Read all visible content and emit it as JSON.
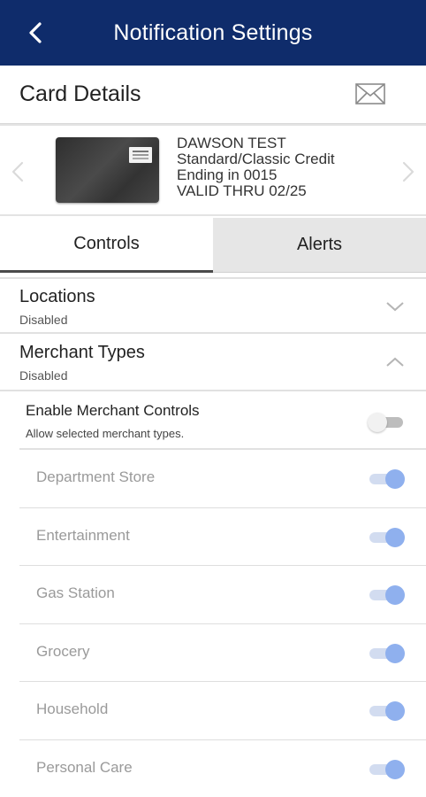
{
  "header": {
    "title": "Notification Settings"
  },
  "card_details": {
    "title": "Card Details"
  },
  "card": {
    "name": "DAWSON TEST",
    "type": "Standard/Classic Credit",
    "ending": "Ending in 0015",
    "valid": "VALID THRU 02/25"
  },
  "tabs": [
    {
      "label": "Controls",
      "active": true
    },
    {
      "label": "Alerts",
      "active": false
    }
  ],
  "sections": {
    "locations": {
      "title": "Locations",
      "status": "Disabled",
      "expanded": false
    },
    "merchant_types": {
      "title": "Merchant Types",
      "status": "Disabled",
      "expanded": true
    }
  },
  "enable_merchant": {
    "title": "Enable Merchant Controls",
    "subtitle": "Allow selected merchant types.",
    "enabled": false
  },
  "merchants": [
    {
      "label": "Department Store",
      "on": true
    },
    {
      "label": "Entertainment",
      "on": true
    },
    {
      "label": "Gas Station",
      "on": true
    },
    {
      "label": "Grocery",
      "on": true
    },
    {
      "label": "Household",
      "on": true
    },
    {
      "label": "Personal Care",
      "on": true
    }
  ],
  "colors": {
    "header_bg": "#0f2c6b",
    "toggle_on": "#8fb0ee",
    "toggle_off": "#bdbdbd"
  }
}
